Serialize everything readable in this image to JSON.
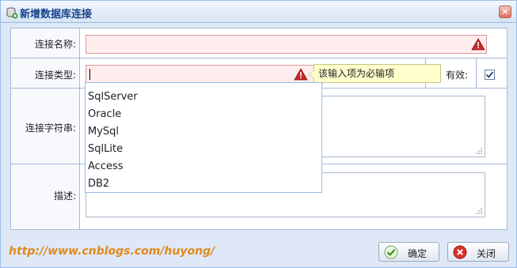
{
  "dialog": {
    "title": "新增数据库连接",
    "close_glyph": "×"
  },
  "form": {
    "name_label": "连接名称:",
    "type_label": "连接类型:",
    "enabled_label": "有效:",
    "enabled_checked": true,
    "conn_label": "连接字符串:",
    "desc_label": "描述:"
  },
  "validation": {
    "tooltip": "该输入项为必输项"
  },
  "dropdown": {
    "options": [
      "SqlServer",
      "Oracle",
      "MySql",
      "SqlLite",
      "Access",
      "DB2"
    ]
  },
  "footer": {
    "watermark": "http://www.cnblogs.com/huyong/",
    "ok_label": "确定",
    "close_label": "关闭"
  },
  "icons": {
    "title": "database-icon",
    "warn": "warning-icon",
    "ok": "check-icon",
    "close": "close-icon"
  },
  "colors": {
    "invalid_bg": "#ffecec",
    "invalid_border": "#d99a9a",
    "tooltip_bg": "#ffffcc",
    "watermark": "#e08a1c"
  }
}
